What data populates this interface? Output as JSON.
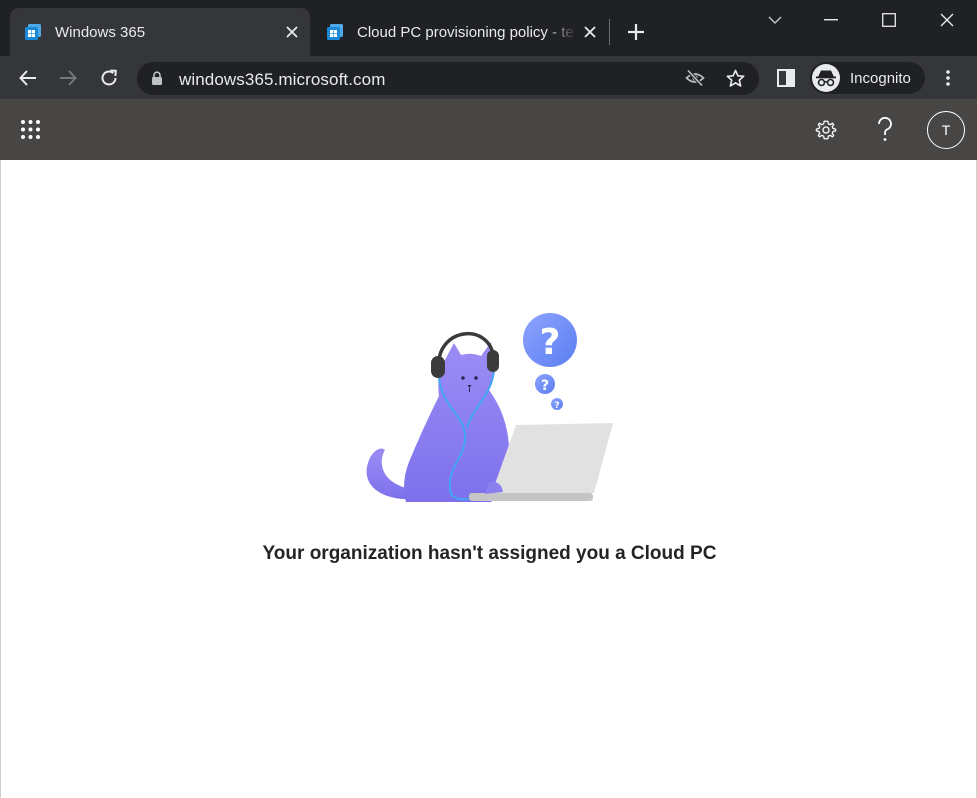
{
  "browser": {
    "tabs": [
      {
        "title": "Windows 365",
        "active": true,
        "icon": "windows365-favicon"
      },
      {
        "title": "Cloud PC provisioning policy - te",
        "active": false,
        "icon": "windows365-favicon"
      }
    ],
    "address": "windows365.microsoft.com",
    "profile_label": "Incognito"
  },
  "app_header": {
    "avatar_initial": "T",
    "icons": [
      "app-launcher-icon",
      "settings-gear-icon",
      "help-icon"
    ]
  },
  "main": {
    "illustration": "cat-with-headphones-laptop-question-marks",
    "message": "Your organization hasn't assigned you a Cloud PC"
  },
  "colors": {
    "titlebar": "#202124",
    "toolbar": "#35363a",
    "app_header": "#484644",
    "cat": "#8b7ff0",
    "question_bubble": "#6e8ff5"
  }
}
